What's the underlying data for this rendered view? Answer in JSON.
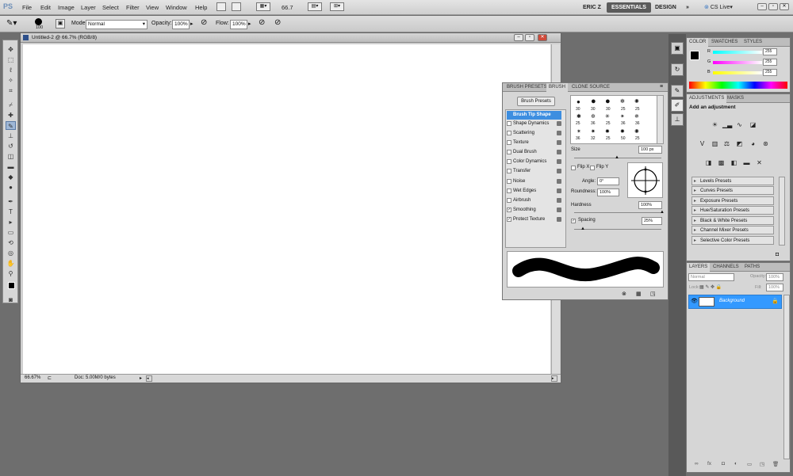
{
  "app": {
    "logo": "PS",
    "menus": [
      "File",
      "Edit",
      "Image",
      "Layer",
      "Select",
      "Filter",
      "View",
      "Window",
      "Help"
    ],
    "zoom": "66.7",
    "user": "ERIC Z",
    "workspaces": [
      "ESSENTIALS",
      "DESIGN"
    ],
    "more": "»",
    "cs_live": "CS Live"
  },
  "options": {
    "brush_size": "100",
    "mode_label": "Mode:",
    "mode_value": "Normal",
    "opacity_label": "Opacity:",
    "opacity_value": "100%",
    "flow_label": "Flow:",
    "flow_value": "100%"
  },
  "document": {
    "title": "Untitled-2 @ 66.7% (RGB/8)",
    "zoom": "66.67%",
    "doc_info": "Doc: 5.00M/0 bytes"
  },
  "brush_panel": {
    "tabs": [
      "BRUSH PRESETS",
      "BRUSH",
      "CLONE SOURCE"
    ],
    "presets_button": "Brush Presets",
    "options": [
      {
        "label": "Brush Tip Shape",
        "checked": "",
        "selected": true
      },
      {
        "label": "Shape Dynamics",
        "checked": ""
      },
      {
        "label": "Scattering",
        "checked": ""
      },
      {
        "label": "Texture",
        "checked": ""
      },
      {
        "label": "Dual Brush",
        "checked": ""
      },
      {
        "label": "Color Dynamics",
        "checked": ""
      },
      {
        "label": "Transfer",
        "checked": ""
      },
      {
        "label": "Noise",
        "checked": ""
      },
      {
        "label": "Wet Edges",
        "checked": ""
      },
      {
        "label": "Airbrush",
        "checked": ""
      },
      {
        "label": "Smoothing",
        "checked": "✓"
      },
      {
        "label": "Protect Texture",
        "checked": "✓"
      }
    ],
    "tip_sizes": [
      "30",
      "30",
      "30",
      "25",
      "25",
      "25",
      "36",
      "25",
      "36",
      "36",
      "36",
      "32",
      "25",
      "50",
      "25"
    ],
    "size_label": "Size",
    "size_value": "100 px",
    "flip_x": "Flip X",
    "flip_y": "Flip Y",
    "angle_label": "Angle:",
    "angle_value": "0°",
    "roundness_label": "Roundness:",
    "roundness_value": "100%",
    "hardness_label": "Hardness",
    "hardness_value": "100%",
    "spacing_label": "Spacing",
    "spacing_value": "25%"
  },
  "color_panel": {
    "tabs": [
      "COLOR",
      "SWATCHES",
      "STYLES"
    ],
    "r_label": "R",
    "g_label": "G",
    "b_label": "B",
    "r": "255",
    "g": "255",
    "b": "255"
  },
  "adjustments": {
    "tabs": [
      "ADJUSTMENTS",
      "MASKS"
    ],
    "heading": "Add an adjustment",
    "presets": [
      "Levels Presets",
      "Curves Presets",
      "Exposure Presets",
      "Hue/Saturation Presets",
      "Black & White Presets",
      "Channel Mixer Presets",
      "Selective Color Presets"
    ]
  },
  "layers": {
    "tabs": [
      "LAYERS",
      "CHANNELS",
      "PATHS"
    ],
    "blend": "Normal",
    "opacity_label": "Opacity:",
    "opacity": "100%",
    "lock_label": "Lock:",
    "fill_label": "Fill:",
    "fill": "100%",
    "layer_name": "Background"
  },
  "colors": {
    "accent": "#3d8ee0",
    "workspace_bg": "#6e6e6e",
    "selection": "#3399ff"
  }
}
